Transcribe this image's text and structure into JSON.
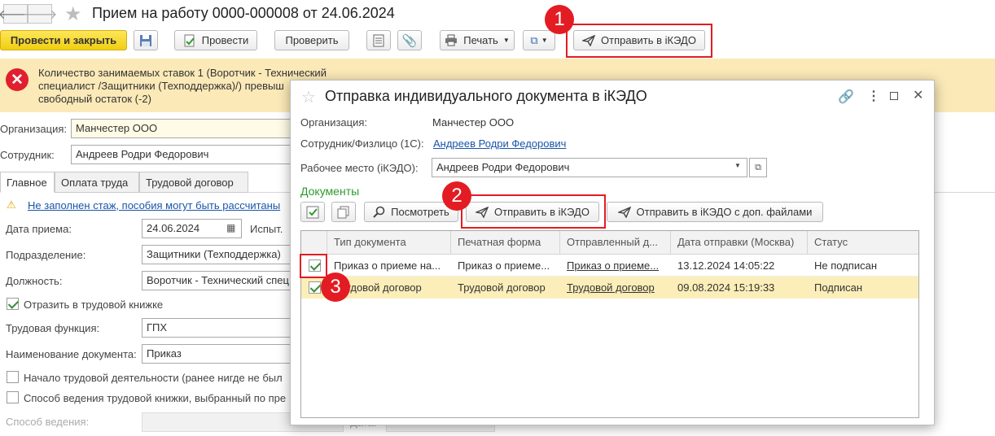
{
  "window": {
    "title": "Прием на работу 0000-000008 от 24.06.2024"
  },
  "toolbar": {
    "post_close": "Провести и закрыть",
    "post": "Провести",
    "check": "Проверить",
    "print": "Печать",
    "send_ikedo": "Отправить в iКЭДО"
  },
  "warning": {
    "line1": "Количество занимаемых ставок 1 (Воротчик - Технический",
    "line2": "специалист /Защитники (Техподдержка)/) превыш",
    "line3": "свободный остаток (-2)"
  },
  "form": {
    "org_label": "Организация:",
    "org_value": "Манчестер ООО",
    "emp_label": "Сотрудник:",
    "emp_value": "Андреев Родри Федорович",
    "tabs": [
      "Главное",
      "Оплата труда",
      "Трудовой договор"
    ],
    "notice": "Не заполнен стаж, пособия могут быть рассчитаны",
    "hire_date_label": "Дата приема:",
    "hire_date_value": "24.06.2024",
    "probation_label": "Испыт.",
    "dept_label": "Подразделение:",
    "dept_value": "Защитники (Техподдержка)",
    "position_label": "Должность:",
    "position_value": "Воротчик - Технический спец",
    "workbook_check": "Отразить в трудовой книжке",
    "labor_func_label": "Трудовая функция:",
    "labor_func_value": "ГПХ",
    "doc_name_label": "Наименование документа:",
    "doc_name_value": "Приказ",
    "start_work_check": "Начало трудовой деятельности (ранее нигде не был",
    "method_check": "Способ ведения трудовой книжки, выбранный по пре",
    "method_label": "Способ ведения:",
    "date_label": "Дата:"
  },
  "dialog": {
    "title": "Отправка индивидуального документа в iКЭДО",
    "org_label": "Организация:",
    "org_value": "Манчестер ООО",
    "emp_label": "Сотрудник/Физлицо (1С):",
    "emp_value": "Андреев Родри Федорович",
    "workplace_label": "Рабочее место (iКЭДО):",
    "workplace_value": "Андреев Родри Федорович",
    "docs_heading": "Документы",
    "view_button": "Посмотреть",
    "send_button": "Отправить в iКЭДО",
    "send_files_button": "Отправить в iКЭДО с доп. файлами",
    "columns": [
      "Тип документа",
      "Печатная форма",
      "Отправленный д...",
      "Дата отправки (Москва)",
      "Статус"
    ],
    "rows": [
      {
        "type": "Приказ о приеме на...",
        "form": "Приказ о приеме...",
        "sent": "Приказ о приеме...",
        "date": "13.12.2024 14:05:22",
        "status": "Не подписан"
      },
      {
        "type": "Трудовой договор",
        "form": "Трудовой договор",
        "sent": "Трудовой договор",
        "date": "09.08.2024 15:19:33",
        "status": "Подписан"
      }
    ]
  },
  "annotations": {
    "b1": "1",
    "b2": "2",
    "b3": "3"
  },
  "colors": {
    "primary_button": "#f5d21a",
    "warning_bg": "#fbe9b7",
    "accent_red": "#e31c23",
    "link": "#1a55a8",
    "docs_heading": "#2e9a2e"
  }
}
